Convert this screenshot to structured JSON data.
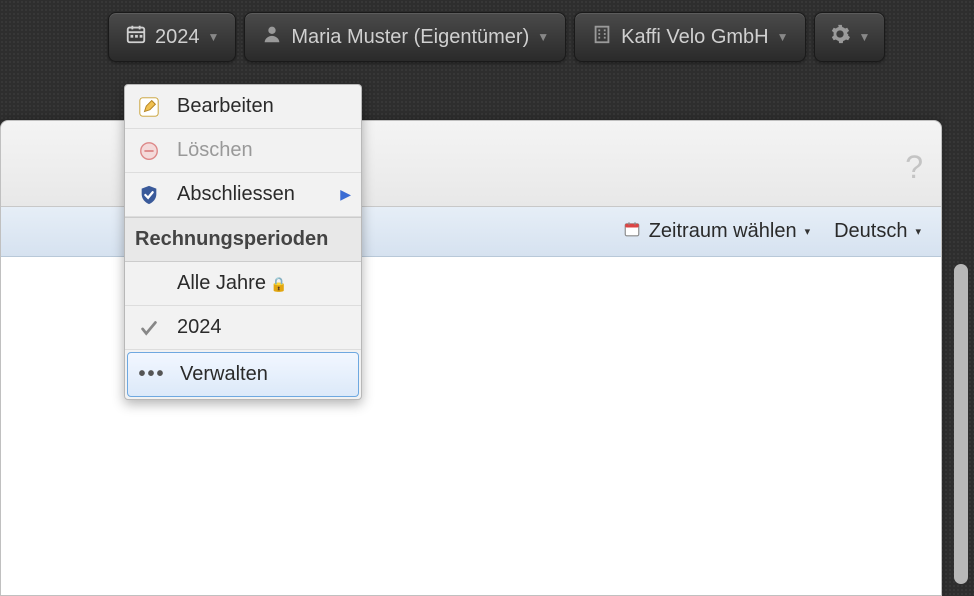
{
  "toolbar": {
    "year": "2024",
    "user": "Maria Muster (Eigentümer)",
    "company": "Kaffi Velo GmbH"
  },
  "dropdown": {
    "edit": "Bearbeiten",
    "delete": "Löschen",
    "close": "Abschliessen",
    "section_header": "Rechnungsperioden",
    "all_years": "Alle Jahre",
    "year_2024": "2024",
    "manage": "Verwalten"
  },
  "subbar": {
    "date_range": "Zeitraum wählen",
    "language": "Deutsch"
  }
}
